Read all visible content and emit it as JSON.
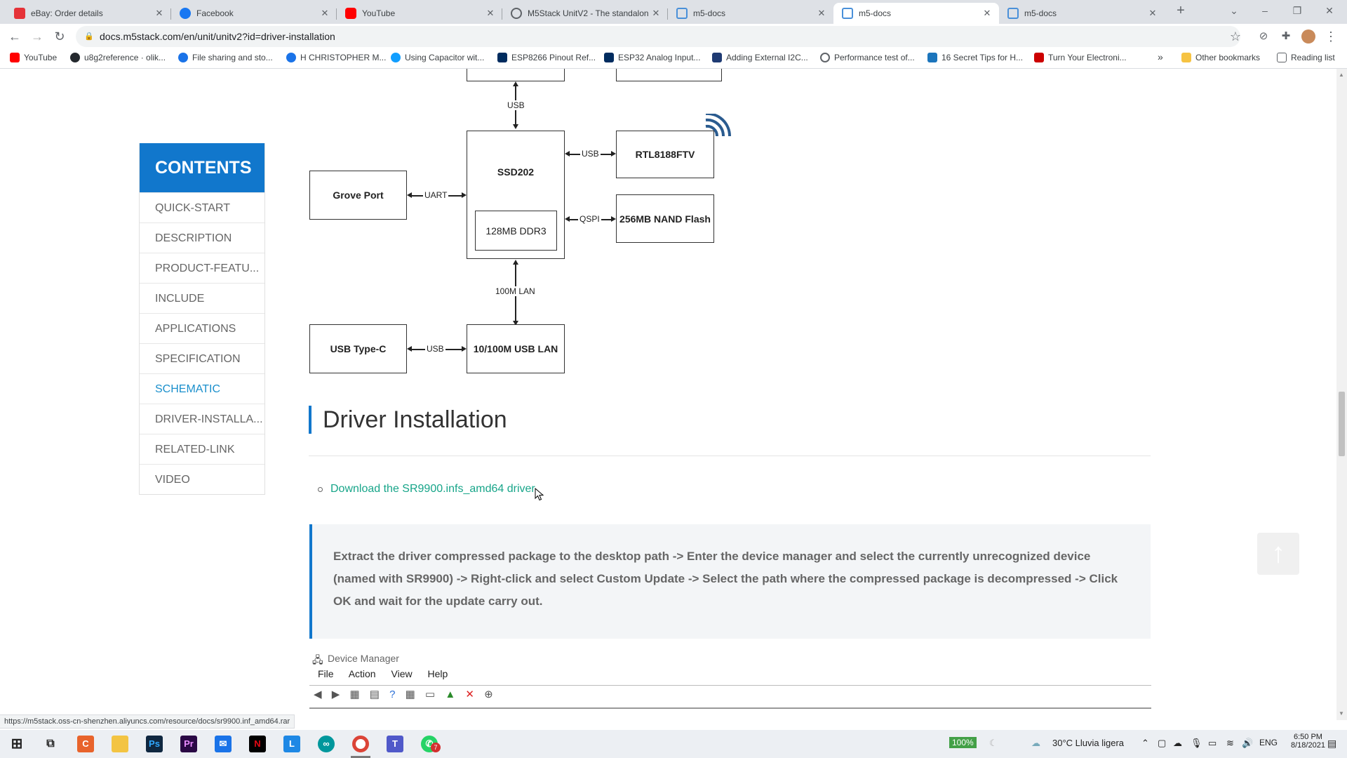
{
  "browser": {
    "tabs": [
      {
        "title": "eBay: Order details",
        "icon": "ebay-icon",
        "color": "#e53238"
      },
      {
        "title": "Facebook",
        "icon": "facebook-icon",
        "color": "#1877f2"
      },
      {
        "title": "YouTube",
        "icon": "youtube-icon",
        "color": "#ff0000"
      },
      {
        "title": "M5Stack UnitV2 - The standalone",
        "icon": "globe-icon",
        "color": "#5f6368"
      },
      {
        "title": "m5-docs",
        "icon": "m5-icon",
        "color": "#4a90d9"
      },
      {
        "title": "m5-docs",
        "icon": "m5-icon",
        "color": "#4a90d9"
      },
      {
        "title": "m5-docs",
        "icon": "m5-icon",
        "color": "#4a90d9"
      }
    ],
    "url": "docs.m5stack.com/en/unit/unitv2?id=driver-installation",
    "bookmarks": [
      {
        "label": "YouTube",
        "icon": "youtube-icon",
        "color": "#ff0000"
      },
      {
        "label": "u8g2reference · olik...",
        "icon": "github-icon",
        "color": "#24292e"
      },
      {
        "label": "File sharing and sto...",
        "icon": "wetransfer-icon",
        "color": "#1a73e8"
      },
      {
        "label": "H CHRISTOPHER M...",
        "icon": "wetransfer-icon",
        "color": "#1a73e8"
      },
      {
        "label": "Using Capacitor wit...",
        "icon": "capacitor-icon",
        "color": "#119eff"
      },
      {
        "label": "ESP8266 Pinout Ref...",
        "icon": "randomnerd-icon",
        "color": "#002c5f"
      },
      {
        "label": "ESP32 Analog Input...",
        "icon": "randomnerd-icon",
        "color": "#002c5f"
      },
      {
        "label": "Adding External I2C...",
        "icon": "hackster-icon",
        "color": "#1f3b73"
      },
      {
        "label": "Performance test of...",
        "icon": "globe-icon",
        "color": "#5f6368"
      },
      {
        "label": "16 Secret Tips for H...",
        "icon": "instructables-icon",
        "color": "#1c75bc"
      },
      {
        "label": "Turn Your Electroni...",
        "icon": "medium-icon",
        "color": "#cc0000"
      }
    ],
    "more_bookmarks": "»",
    "other_bookmarks": "Other bookmarks",
    "reading_list": "Reading list",
    "status_url": "https://m5stack.oss-cn-shenzhen.aliyuncs.com/resource/docs/sr9900.inf_amd64.rar"
  },
  "toc": {
    "title": "CONTENTS",
    "items": [
      {
        "label": "QUICK-START",
        "active": false
      },
      {
        "label": "DESCRIPTION",
        "active": false
      },
      {
        "label": "PRODUCT-FEATU...",
        "active": false
      },
      {
        "label": "INCLUDE",
        "active": false
      },
      {
        "label": "APPLICATIONS",
        "active": false
      },
      {
        "label": "SPECIFICATION",
        "active": false
      },
      {
        "label": "SCHEMATIC",
        "active": true
      },
      {
        "label": "DRIVER-INSTALLA...",
        "active": false
      },
      {
        "label": "RELATED-LINK",
        "active": false
      },
      {
        "label": "VIDEO",
        "active": false
      }
    ]
  },
  "schematic": {
    "blocks": {
      "ssd202": "SSD202",
      "ddr3": "128MB DDR3",
      "rtl": "RTL8188FTV",
      "nand": "256MB NAND Flash",
      "grove": "Grove Port",
      "usbc": "USB Type-C",
      "lan": "10/100M USB LAN"
    },
    "labels": {
      "usb_top": "USB",
      "usb_rtl": "USB",
      "qspi": "QSPI",
      "uart": "UART",
      "lan100": "100M LAN",
      "usb_c": "USB"
    }
  },
  "section": {
    "heading": "Driver Installation",
    "download_link": "Download the SR9900.infs_amd64 driver",
    "tip": "Extract the driver compressed package to the desktop path -> Enter the device manager and select the currently unrecognized device (named with SR9900) -> Right-click and select Custom Update -> Select the path where the compressed package is decompressed -> Click OK and wait for the update carry out."
  },
  "device_manager": {
    "title": "Device Manager",
    "menu": [
      "File",
      "Action",
      "View",
      "Help"
    ]
  },
  "taskbar": {
    "battery": "100%",
    "weather": "30°C  Lluvia ligera",
    "language": "ENG",
    "time": "6:50 PM",
    "date": "8/18/2021",
    "notification_count": "7"
  }
}
